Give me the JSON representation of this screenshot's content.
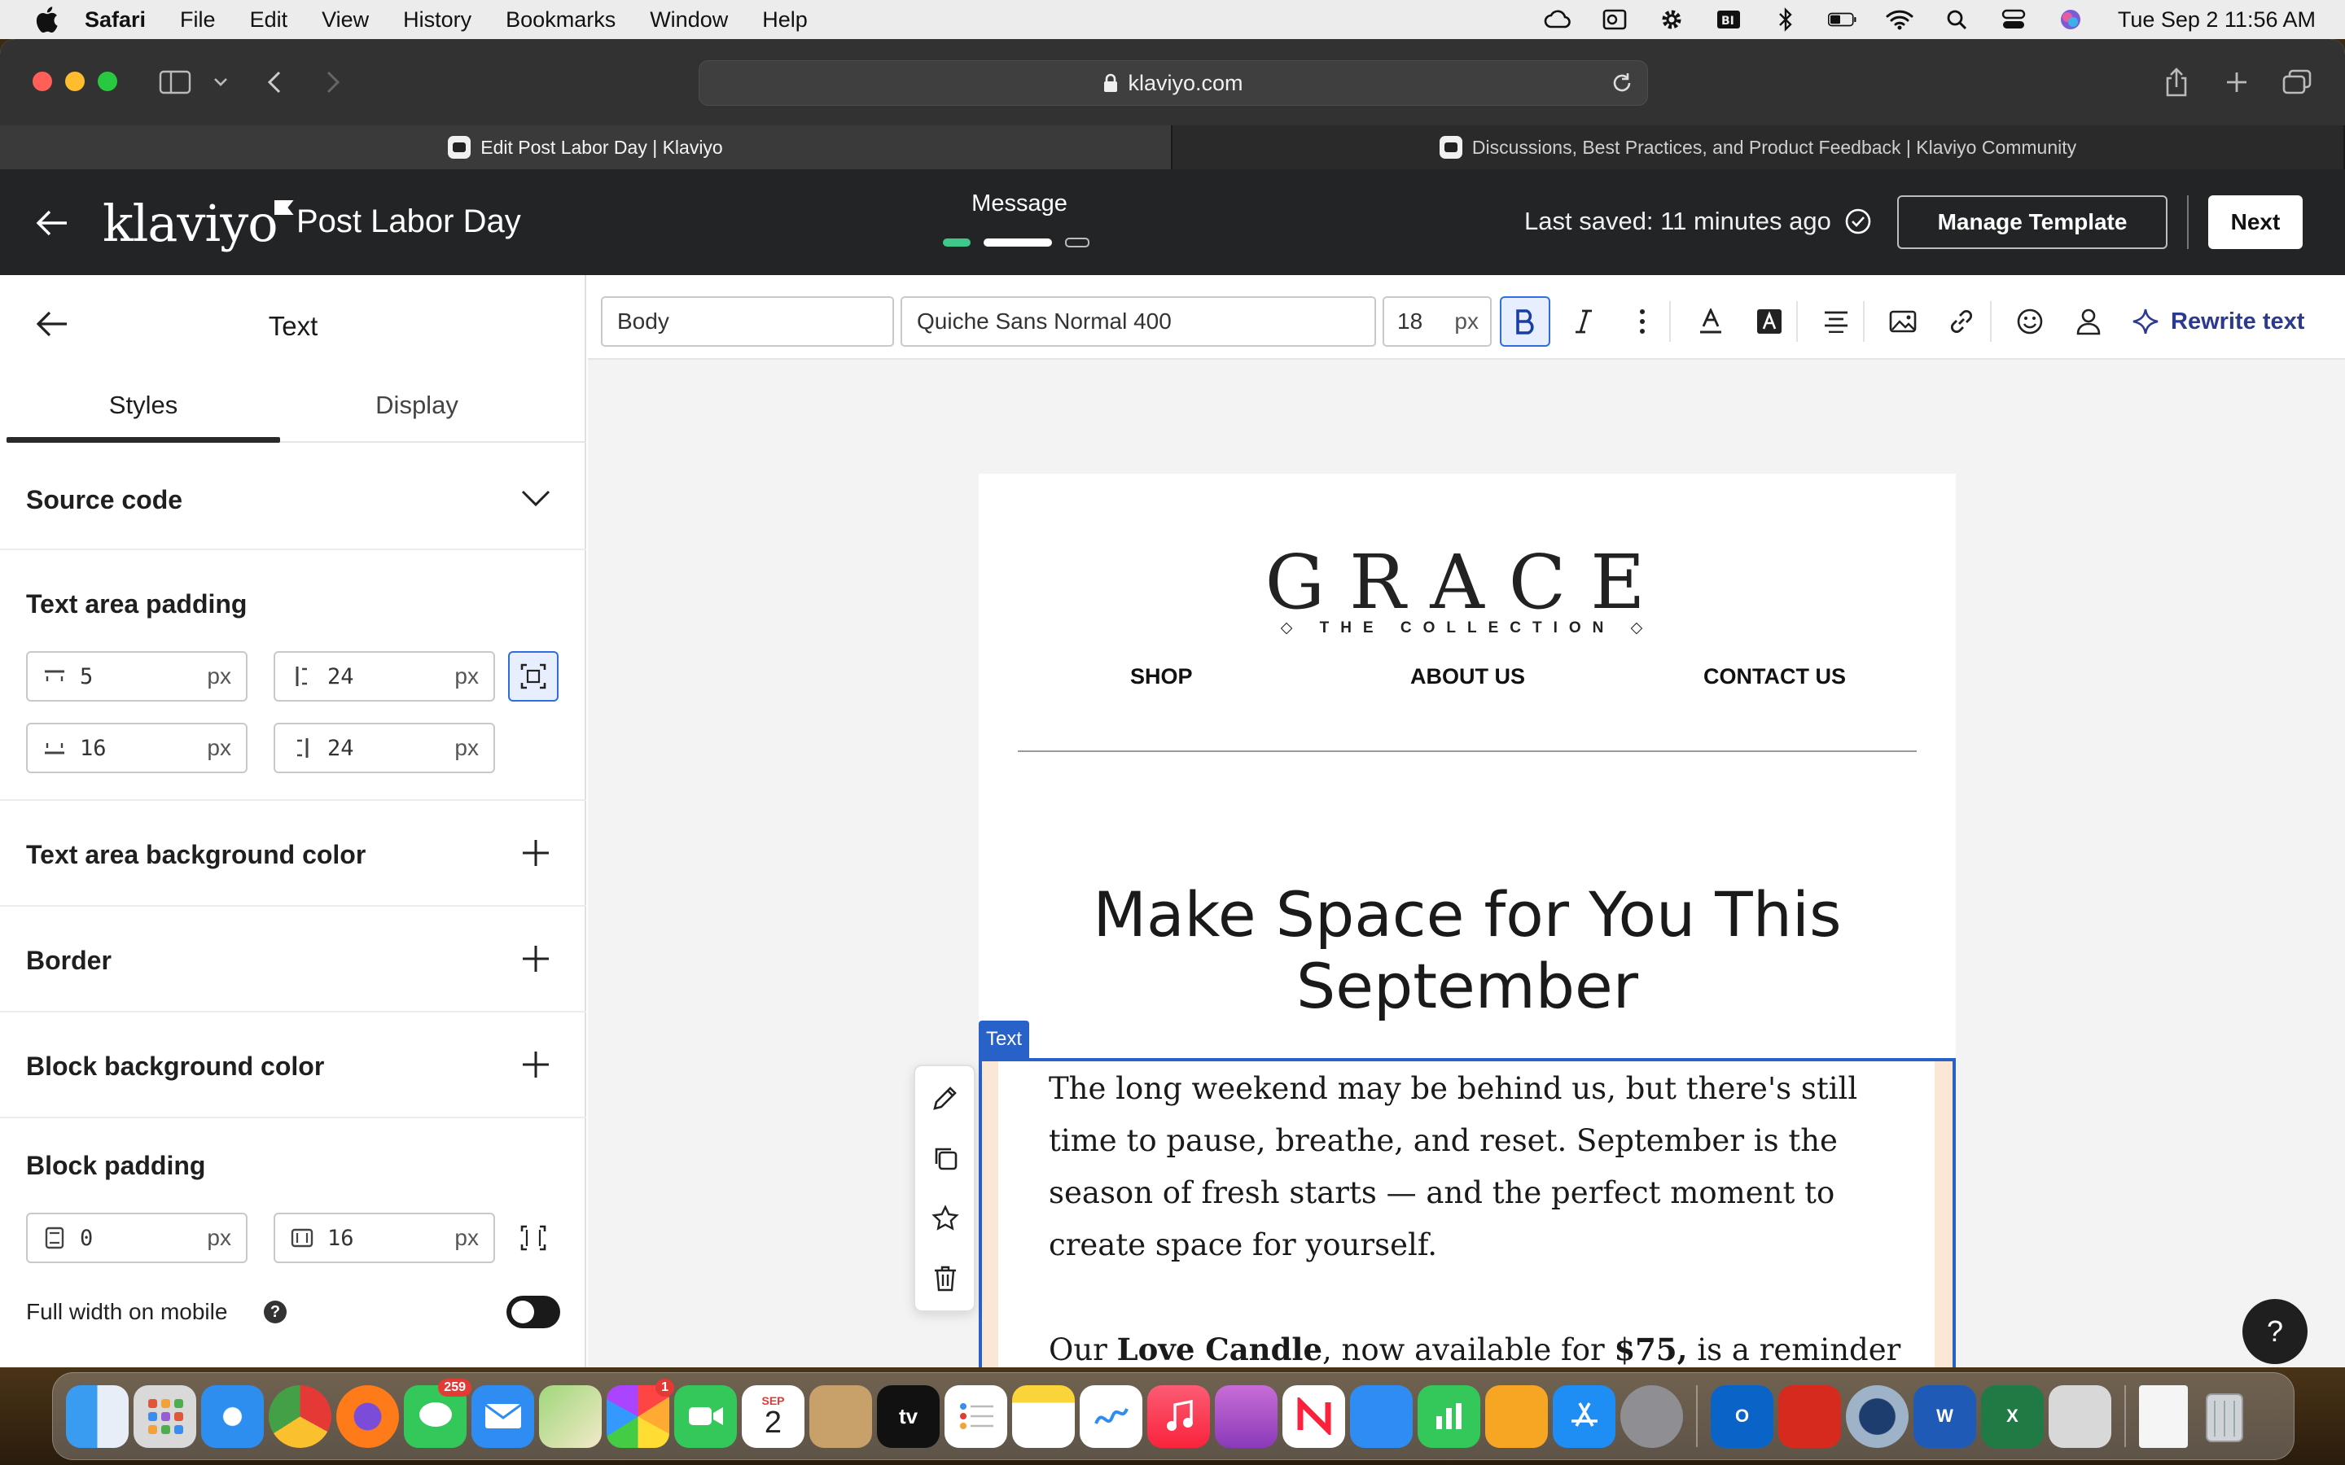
{
  "menubar": {
    "app_name": "Safari",
    "items": [
      "File",
      "Edit",
      "View",
      "History",
      "Bookmarks",
      "Window",
      "Help"
    ],
    "clock": "Tue Sep 2  11:56 AM"
  },
  "browser": {
    "url": "klaviyo.com",
    "tabs": [
      {
        "label": "Edit Post Labor Day | Klaviyo",
        "active": true
      },
      {
        "label": "Discussions, Best Practices, and Product Feedback | Klaviyo Community",
        "active": false
      }
    ]
  },
  "header": {
    "logo": "klaviyo",
    "campaign_title": "Post Labor Day",
    "center_label": "Message",
    "last_saved": "Last saved: 11 minutes ago",
    "manage_template": "Manage Template",
    "next": "Next",
    "step_colors": [
      "#3ec98a",
      "#ffffff",
      "#555555"
    ]
  },
  "panel": {
    "title": "Text",
    "tabs": [
      "Styles",
      "Display"
    ],
    "active_tab": "Styles",
    "sections": {
      "source_code": "Source code",
      "text_area_padding": "Text area padding",
      "text_area_bg": "Text area background color",
      "border": "Border",
      "block_bg": "Block background color",
      "block_padding": "Block padding",
      "full_width_mobile": "Full width on mobile"
    },
    "text_padding": {
      "top": "5",
      "left": "24",
      "bottom": "16",
      "right": "24",
      "unit": "px"
    },
    "block_padding_values": {
      "vertical": "0",
      "horizontal": "16",
      "unit": "px"
    }
  },
  "editor_toolbar": {
    "style_select": "Body",
    "font_select": "Quiche Sans Normal 400",
    "font_size": "18",
    "font_unit": "px",
    "rewrite": "Rewrite text"
  },
  "email": {
    "brand": "GRACE",
    "brand_sub": "THE COLLECTION",
    "nav": [
      "SHOP",
      "ABOUT US",
      "CONTACT US"
    ],
    "headline": "Make Space for You This September",
    "text_tag": "Text",
    "para1": "The long weekend may be behind us, but there's still time to pause, breathe, and reset.  September is the season of fresh starts — and the perfect moment to create space for yourself.",
    "para2_a": "Our ",
    "para2_b": "Love Candle",
    "para2_c": ", now available for ",
    "para2_d": "$75,",
    "para2_e": " is a reminder to slow down and bring warmth back into your home. And for"
  },
  "help_fab": "?",
  "dock": {
    "messages_badge": "259",
    "photos_badge": "1",
    "calendar_month": "SEP",
    "calendar_day": "2",
    "tv_label": "tv"
  }
}
